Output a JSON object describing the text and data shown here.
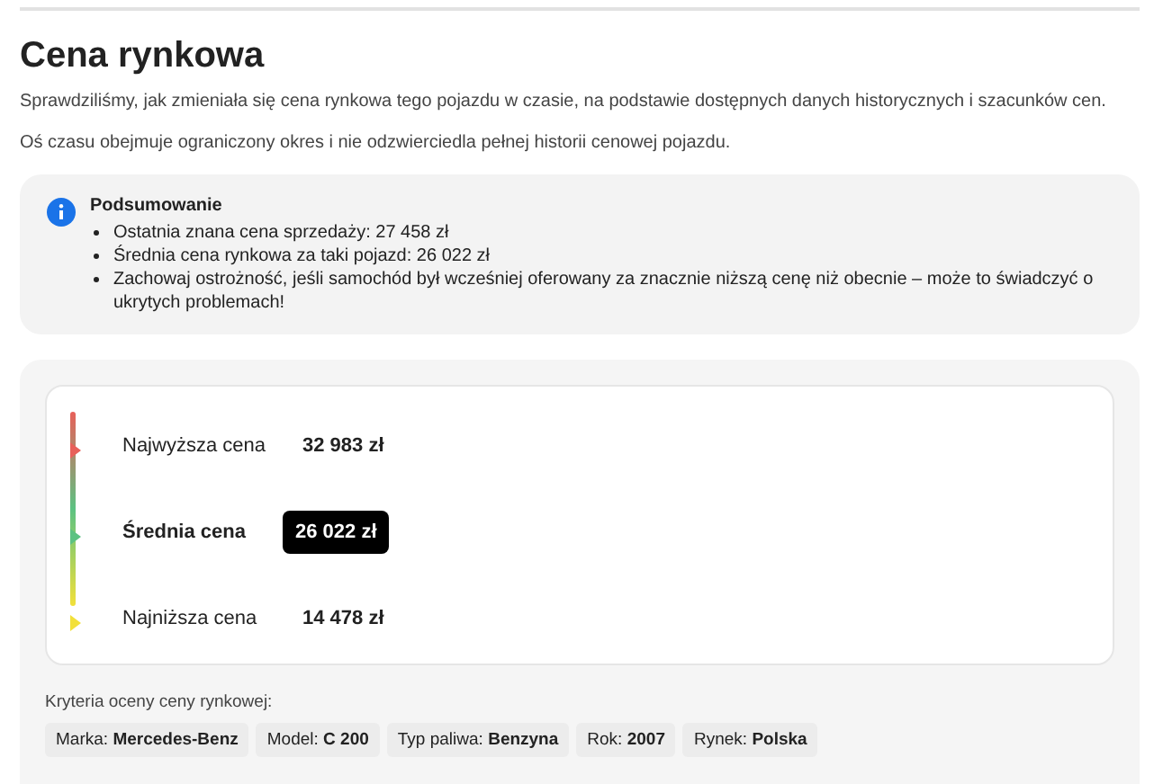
{
  "title": "Cena rynkowa",
  "paragraphs": [
    "Sprawdziliśmy, jak zmieniała się cena rynkowa tego pojazdu w czasie, na podstawie dostępnych danych historycznych i szacunków cen.",
    "Oś czasu obejmuje ograniczony okres i nie odzwierciedla pełnej historii cenowej pojazdu."
  ],
  "summary": {
    "title": "Podsumowanie",
    "items": [
      "Ostatnia znana cena sprzedaży: 27 458 zł",
      "Średnia cena rynkowa za taki pojazd: 26 022 zł",
      "Zachowaj ostrożność, jeśli samochód był wcześniej oferowany za znacznie niższą cenę niż obecnie – może to świadczyć o ukrytych problemach!"
    ]
  },
  "prices": [
    {
      "label": "Najwyższa cena",
      "value": "32 983 zł",
      "color": "#e8605a",
      "highlighted": false
    },
    {
      "label": "Średnia cena",
      "value": "26 022 zł",
      "color": "#5cc282",
      "highlighted": true
    },
    {
      "label": "Najniższa cena",
      "value": "14 478 zł",
      "color": "#f2e03a",
      "highlighted": false
    }
  ],
  "criteria": {
    "title": "Kryteria oceny ceny rynkowej:",
    "tags": [
      "Marka: **Mercedes-Benz**",
      "Model: **C 200**",
      "Typ paliwa: **Benzyna**",
      "Rok: **2007**",
      "Rynek: **Polska**"
    ]
  }
}
